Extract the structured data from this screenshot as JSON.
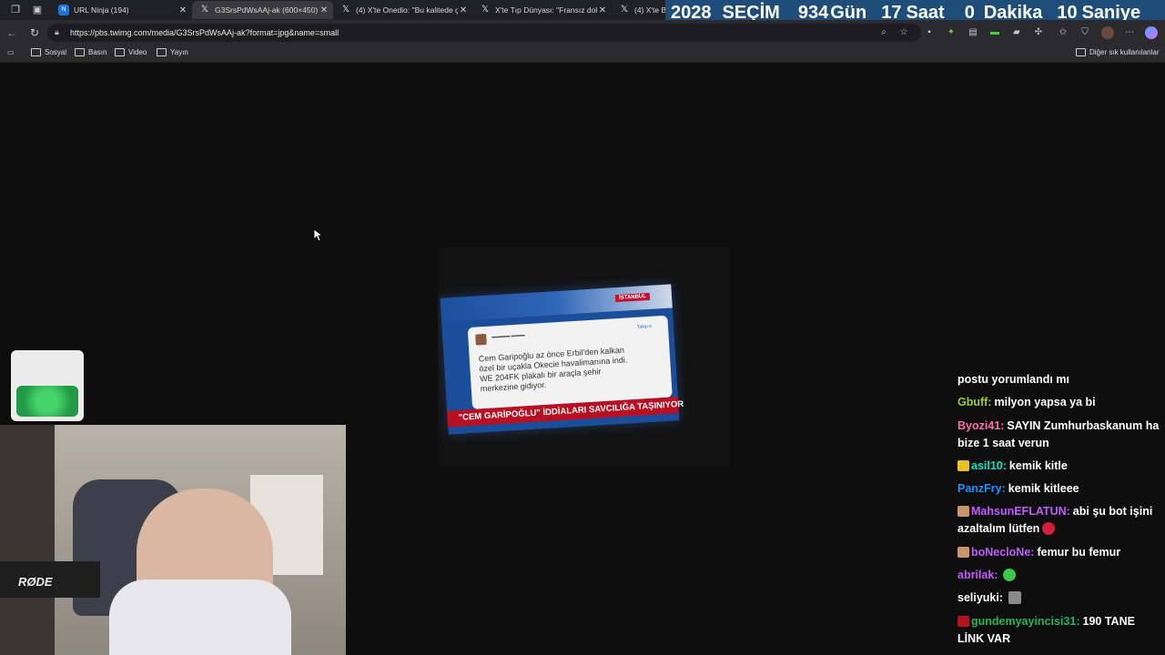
{
  "browser": {
    "tabs": [
      {
        "title": "URL Ninja (194)",
        "icon": "url-ninja-favicon",
        "active": false
      },
      {
        "title": "G3SrsPdWsAAj-ak (600×450)",
        "icon": "x-logo-icon",
        "active": true
      },
      {
        "title": "(4) X'te Onedio: \"Bu kalitede çe",
        "icon": "x-logo-icon",
        "active": false
      },
      {
        "title": "X'te Tıp Dünyası: \"Fransız dokto",
        "icon": "x-logo-icon",
        "active": false
      },
      {
        "title": "(4) X'te Be",
        "icon": "x-logo-icon",
        "active": false
      }
    ],
    "url": "https://pbs.twimg.com/media/G3SrsPdWsAAj-ak?format=jpg&name=small",
    "bookmarks": [
      "Sosyal",
      "Basın",
      "Video",
      "Yayın"
    ],
    "other_bookmarks": "Diğer sık kullanılanlar"
  },
  "countdown": {
    "year": "2028",
    "label": "SEÇİM",
    "days": "934",
    "days_unit": "Gün",
    "hours": "17",
    "hours_unit": "Saat",
    "minutes": "0",
    "minutes_unit": "Dakika",
    "seconds": "10",
    "seconds_unit": "Saniye"
  },
  "photo": {
    "city_tag": "İSTANBUL",
    "tweet_follow": "Takip e",
    "tweet_lines": [
      "Cem Garipoğlu az önce Erbil'den kalkan",
      "özel bir uçakla Okecie havalimanına indi.",
      "WE 204FK plakalı bir araçla şehir",
      "merkezine gidiyor."
    ],
    "banner": "\"CEM GARİPOĞLU\" İDDİALARI SAVCILIĞA TAŞINIYOR"
  },
  "webcam": {
    "mic_brand": "RØDE"
  },
  "chat": {
    "messages": [
      {
        "user": "",
        "text": "postu yorumlandı mı",
        "color": "#ffffff",
        "badge": "",
        "emote": ""
      },
      {
        "user": "Gbuff:",
        "text": "milyon yapsa ya bi",
        "color": "#9acd32",
        "badge": "",
        "emote": ""
      },
      {
        "user": "Byozi41:",
        "text": "SAYIN Zumhurbaskanum ha bize 1 saat verun",
        "color": "#ff69b4",
        "badge": "",
        "emote": ""
      },
      {
        "user": "asil10:",
        "text": "kemik kitle",
        "color": "#00e5c0",
        "badge": "#e6c229",
        "emote": ""
      },
      {
        "user": "PanzFry:",
        "text": "kemik kitleee",
        "color": "#1e90ff",
        "badge": "",
        "emote": ""
      },
      {
        "user": "MahsunEFLATUN:",
        "text": "abi şu bot işini azaltalım lütfen",
        "color": "#c25bff",
        "badge": "#c9966b",
        "emote": "#d21f3c"
      },
      {
        "user": "boNecloNe:",
        "text": "femur bu femur",
        "color": "#c25bff",
        "badge": "#c9966b",
        "emote": ""
      },
      {
        "user": "abrilak:",
        "text": "",
        "color": "#c25bff",
        "badge": "",
        "emote": "#39c94b"
      },
      {
        "user": "seliyuki:",
        "text": "",
        "color": "#ffffff",
        "badge": "",
        "emote": "#8a8a8a"
      },
      {
        "user": "gundemyayincisi31:",
        "text": "190 TANE LİNK VAR",
        "color": "#22b35e",
        "badge": "#b3121f",
        "emote": ""
      }
    ]
  }
}
